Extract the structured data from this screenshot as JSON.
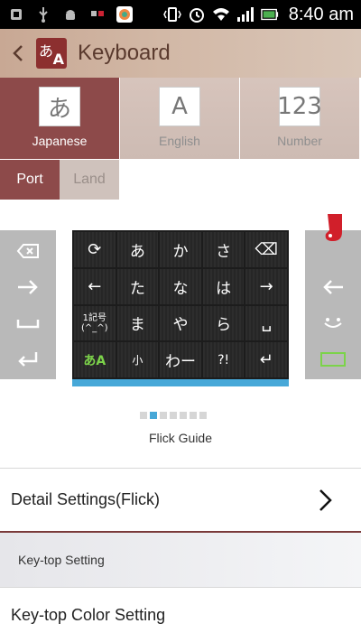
{
  "status_bar": {
    "time": "8:40 am",
    "icons": [
      "usb-icon",
      "usb-debug-icon",
      "android-icon",
      "app-switch-icon",
      "app-icon",
      "vibrate-icon",
      "alarm-icon",
      "wifi-icon",
      "signal-icon",
      "battery-icon"
    ]
  },
  "action_bar": {
    "title": "Keyboard",
    "icon_text_1": "あ",
    "icon_text_2": "A"
  },
  "language_tabs": [
    {
      "label": "Japanese",
      "glyph": "あ",
      "active": true
    },
    {
      "label": "English",
      "glyph": "A",
      "active": false
    },
    {
      "label": "Number",
      "glyph": "123",
      "active": false
    }
  ],
  "orientation_tabs": [
    {
      "label": "Port",
      "active": true
    },
    {
      "label": "Land",
      "active": false
    }
  ],
  "keyboard": {
    "keys": [
      "⟳",
      "あ",
      "か",
      "さ",
      "⌫",
      "←",
      "た",
      "な",
      "は",
      "→",
      "1記号\n(^_^)",
      "ま",
      "や",
      "ら",
      "␣",
      "あA",
      "小",
      "わー",
      "?!",
      "↵"
    ]
  },
  "pager": {
    "count": 7,
    "active_index": 1
  },
  "flick_guide_label": "Flick Guide",
  "settings": {
    "detail_settings": "Detail Settings(Flick)",
    "keytop_section": "Key-top Setting",
    "keytop_color": "Key-top Color Setting"
  },
  "colors": {
    "accent_maroon": "#8d4a4a",
    "accent_blue": "#47a8d8"
  }
}
